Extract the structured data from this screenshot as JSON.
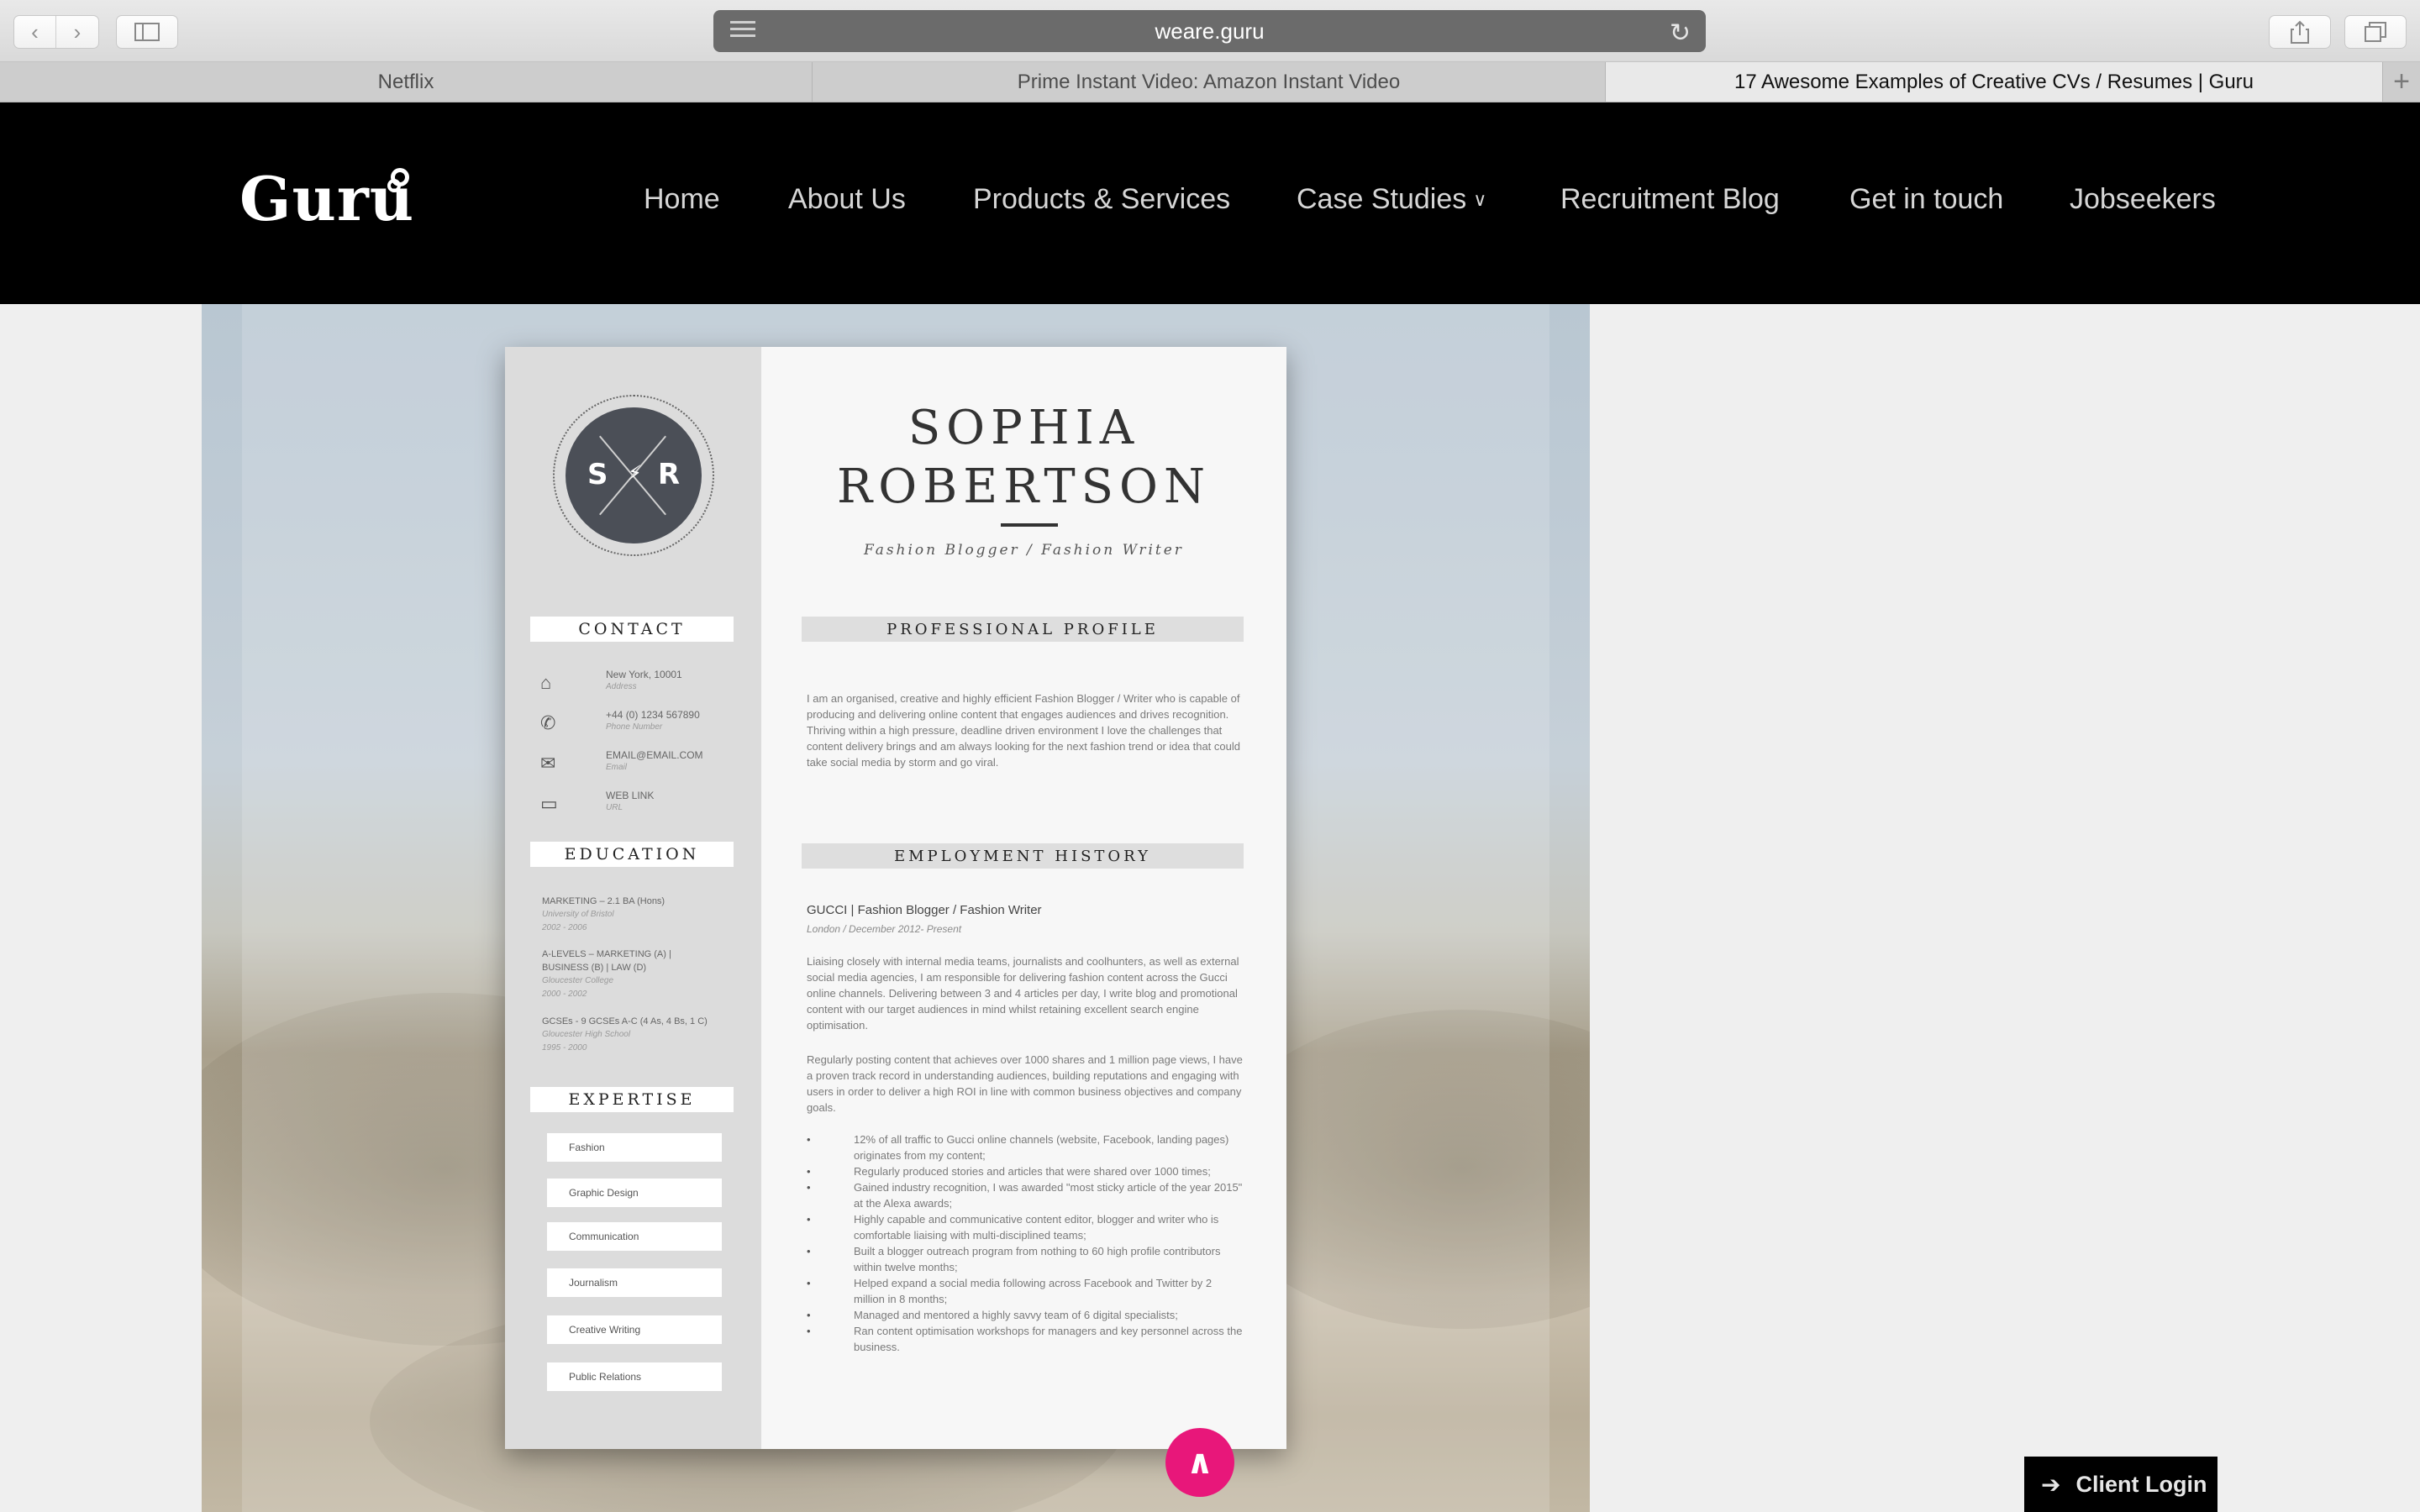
{
  "browser": {
    "url": "weare.guru",
    "tabs": [
      {
        "label": "Netflix",
        "active": false
      },
      {
        "label": "Prime Instant Video: Amazon Instant Video",
        "active": false
      },
      {
        "label": "17 Awesome Examples of Creative CVs / Resumes | Guru",
        "active": true
      }
    ],
    "new_tab_glyph": "+"
  },
  "site": {
    "logo": "Guru",
    "menu": [
      "Home",
      "About Us",
      "Products & Services",
      "Case Studies",
      "Recruitment Blog",
      "Get in touch",
      "Jobseekers"
    ],
    "accent_color": "#e8177a",
    "client_login_label": "Client Login"
  },
  "resume": {
    "monogram_left": "S",
    "monogram_right": "R",
    "first_name": "SOPHIA",
    "last_name": "ROBERTSON",
    "subtitle": "Fashion Blogger / Fashion Writer",
    "contact_heading": "CONTACT",
    "contacts": [
      {
        "value": "New York, 10001",
        "label": "Address",
        "icon": "map-icon"
      },
      {
        "value": "+44 (0) 1234 567890",
        "label": "Phone Number",
        "icon": "phone-icon"
      },
      {
        "value": "EMAIL@EMAIL.COM",
        "label": "Email",
        "icon": "envelope-icon"
      },
      {
        "value": "WEB LINK",
        "label": "URL",
        "icon": "monitor-icon"
      }
    ],
    "education_heading": "EDUCATION",
    "education": [
      {
        "line1": "MARKETING – 2.1 BA (Hons)",
        "line2": "",
        "school": "University of Bristol",
        "years": "2002 - 2006"
      },
      {
        "line1": "A-LEVELS – MARKETING (A) |",
        "line2": "BUSINESS (B) | LAW (D)",
        "school": "Gloucester College",
        "years": "2000 - 2002"
      },
      {
        "line1": "GCSEs - 9 GCSEs A-C (4 As, 4 Bs, 1 C)",
        "line2": "",
        "school": "Gloucester High School",
        "years": "1995 - 2000"
      }
    ],
    "expertise_heading": "EXPERTISE",
    "expertise": [
      "Fashion",
      "Graphic Design",
      "Communication",
      "Journalism",
      "Creative Writing",
      "Public Relations"
    ],
    "profile_heading": "PROFESSIONAL PROFILE",
    "profile_text": "I am an organised, creative and highly efficient Fashion Blogger / Writer who is capable of producing and delivering online content that engages audiences and drives recognition. Thriving within a high pressure, deadline driven environment I love the challenges that content delivery brings and am always looking for the next fashion trend or idea that could take social media by storm and go viral.",
    "employment_heading": "EMPLOYMENT HISTORY",
    "job_title": "GUCCI | Fashion Blogger / Fashion Writer",
    "job_meta": "London / December 2012- Present",
    "job_para1": "Liaising closely with internal media teams, journalists and coolhunters, as well as external social media agencies, I am responsible for delivering fashion content across the Gucci online channels. Delivering between 3 and 4 articles per day, I write blog and promotional content with our target audiences in mind whilst retaining excellent search engine optimisation.",
    "job_para2": "Regularly posting content that achieves over 1000 shares and 1 million page views, I have a proven track record in understanding audiences, building reputations and engaging with users in order to deliver a high ROI in line with common business objectives and company goals.",
    "achievements": [
      "12% of all traffic to Gucci online channels (website, Facebook, landing pages) originates from my content;",
      "Regularly produced stories and articles that were shared over 1000 times;",
      "Gained industry recognition, I was awarded \"most sticky article of the year 2015\" at the Alexa awards;",
      "Highly capable and communicative content editor, blogger and writer who is comfortable liaising with multi-disciplined teams;",
      "Built a blogger outreach program from nothing to 60 high profile contributors within twelve months;",
      "Helped expand a social media following across Facebook and Twitter by 2 million in 8 months;",
      "Managed and mentored a highly savvy team of 6 digital specialists;",
      "Ran content optimisation workshops for managers and key personnel across the business."
    ]
  }
}
